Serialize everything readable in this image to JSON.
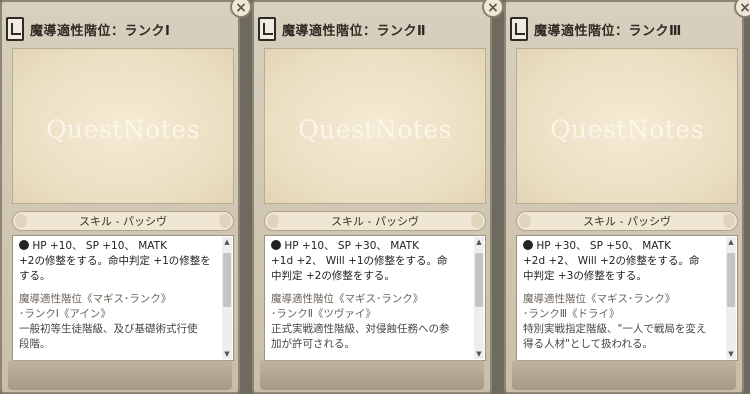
{
  "panels": [
    {
      "title": "魔導適性階位：ランクⅠ",
      "watermark": "QuestNotes",
      "skill_label": "スキル - パッシヴ",
      "stats_line1": "HP +10、 SP +10、 MATK",
      "stats_line2": "+2の修整をする。命中判定 +1の修整を",
      "stats_line3": "する。",
      "flavor_line1": "魔導適性階位《マギス･ランク》",
      "flavor_line2": "･ランクⅠ《アイン》",
      "desc_line1": "一般初等生徒階級、及び基礎術式行使",
      "desc_line2": "段階。",
      "close": "×"
    },
    {
      "title": "魔導適性階位：ランクⅡ",
      "watermark": "QuestNotes",
      "skill_label": "スキル - パッシヴ",
      "stats_line1": "HP +10、 SP +30、 MATK",
      "stats_line2": "+1d +2、 Will +1の修整をする。命",
      "stats_line3": "中判定 +2の修整をする。",
      "flavor_line1": "魔導適性階位《マギス･ランク》",
      "flavor_line2": "･ランクⅡ《ツヴァイ》",
      "desc_line1": "正式実戦適性階級、対侵蝕任務への参",
      "desc_line2": "加が許可される。",
      "close": "×"
    },
    {
      "title": "魔導適性階位：ランクⅢ",
      "watermark": "QuestNotes",
      "skill_label": "スキル - パッシヴ",
      "stats_line1": "HP +30、 SP +50、 MATK",
      "stats_line2": "+2d +2、 Will +2の修整をする。命",
      "stats_line3": "中判定 +3の修整をする。",
      "flavor_line1": "魔導適性階位《マギス･ランク》",
      "flavor_line2": "･ランクⅢ《ドライ》",
      "desc_line1": "特別実戦指定階級、\"一人で戦局を変え",
      "desc_line2": "得る人材\"として扱われる。",
      "close": "×"
    }
  ]
}
